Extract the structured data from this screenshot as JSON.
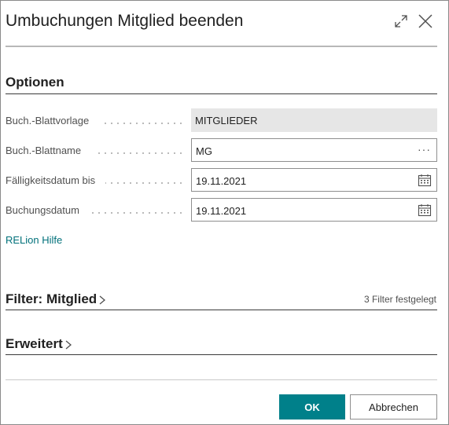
{
  "dialog": {
    "title": "Umbuchungen Mitglied beenden",
    "expand_icon": "expand-icon",
    "close_icon": "close-icon"
  },
  "options": {
    "heading": "Optionen",
    "fields": [
      {
        "label": "Buch.-Blattvorlage",
        "value": "MITGLIEDER",
        "readonly": true
      },
      {
        "label": "Buch.-Blattname",
        "value": "MG",
        "icon": "ellipsis-icon",
        "icon_text": "···"
      },
      {
        "label": "Fälligkeitsdatum bis",
        "value": "19.11.2021",
        "icon": "calendar-icon"
      },
      {
        "label": "Buchungsdatum",
        "value": "19.11.2021",
        "icon": "calendar-icon"
      }
    ],
    "help_link": "RELion Hilfe"
  },
  "filter": {
    "heading": "Filter: Mitglied",
    "status": "3 Filter festgelegt"
  },
  "advanced": {
    "heading": "Erweitert"
  },
  "buttons": {
    "ok": "OK",
    "cancel": "Abbrechen"
  },
  "colors": {
    "accent": "#00808a",
    "link": "#00707a",
    "readonly_bg": "#e6e6e6"
  }
}
